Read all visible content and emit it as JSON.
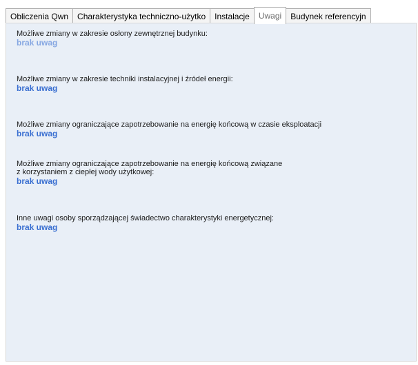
{
  "tabs": [
    {
      "label": "Obliczenia Qwn"
    },
    {
      "label": "Charakterystyka techniczno-użytko"
    },
    {
      "label": "Instalacje"
    },
    {
      "label": "Uwagi"
    },
    {
      "label": "Budynek referencyjn"
    }
  ],
  "active_tab": "Uwagi",
  "sections": [
    {
      "question": "Możliwe zmiany w zakresie osłony zewnętrznej budynku:",
      "answer": "brak uwag"
    },
    {
      "question": "Możliwe zmiany w zakresie techniki instalacyjnej i źródeł energii:",
      "answer": "brak uwag"
    },
    {
      "question": "Możliwe zmiany ograniczające zapotrzebowanie na energię końcową w czasie eksploatacji",
      "answer": "brak uwag"
    },
    {
      "question": "Możliwe zmiany ograniczające zapotrzebowanie na energię końcową związane\nz korzystaniem z ciepłej wody użytkowej:",
      "answer": "brak uwag"
    },
    {
      "question": "Inne uwagi osoby sporządzającej świadectwo charakterystyki energetycznej:",
      "answer": "brak uwag"
    }
  ],
  "colors": {
    "panel_background": "#e9eff7",
    "answer_text": "#3a6fd1"
  }
}
